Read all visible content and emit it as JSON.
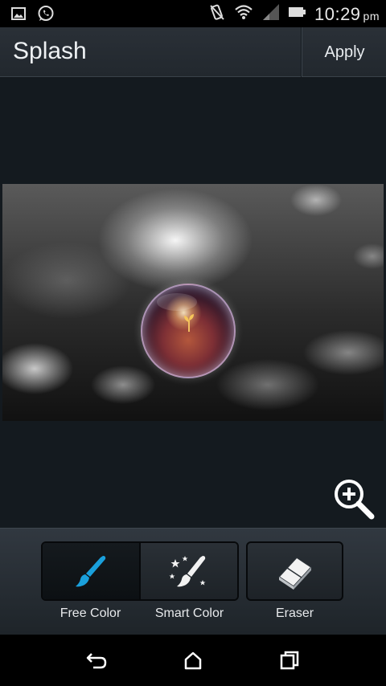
{
  "status_bar": {
    "time": "10:29",
    "ampm": "pm",
    "left_icons": [
      "gallery-icon",
      "whatsapp-icon"
    ],
    "right_icons": [
      "vibrate-icon",
      "wifi-icon",
      "signal-icon",
      "battery-icon"
    ]
  },
  "action_bar": {
    "title": "Splash",
    "apply_label": "Apply"
  },
  "canvas": {
    "zoom_icon": "zoom-in-icon"
  },
  "tools": [
    {
      "label": "Free Color",
      "icon": "brush-icon",
      "active": true
    },
    {
      "label": "Smart Color",
      "icon": "magic-brush-icon",
      "active": false
    },
    {
      "label": "Eraser",
      "icon": "eraser-icon",
      "active": false
    }
  ],
  "nav_bar": {
    "icons": [
      "back-icon",
      "home-icon",
      "recents-icon"
    ]
  },
  "colors": {
    "accent": "#1aa0dc",
    "background": "#13171b",
    "action_bar": "#262c32"
  }
}
